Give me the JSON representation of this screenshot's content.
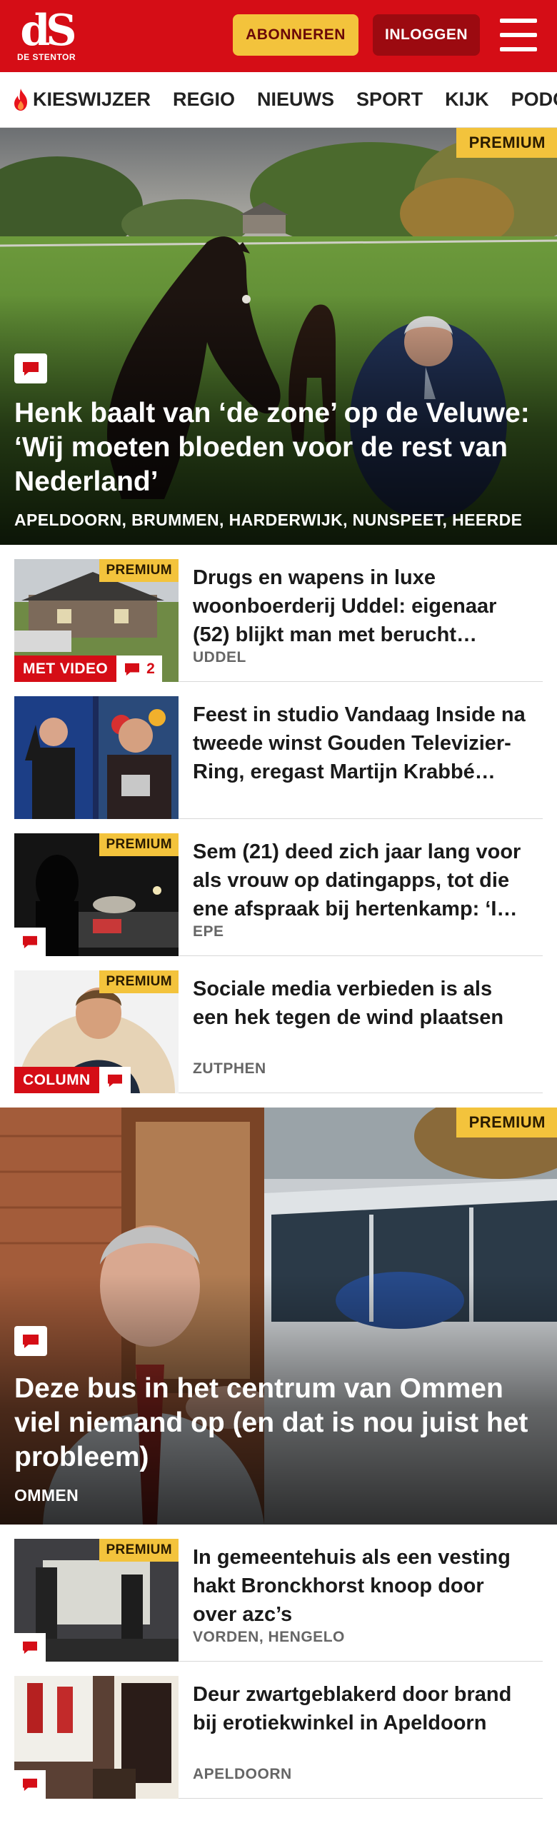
{
  "header": {
    "logo_mark": "dS",
    "logo_sub": "DE STENTOR",
    "subscribe_label": "ABONNEREN",
    "login_label": "INLOGGEN"
  },
  "nav": {
    "items": [
      "KIESWIJZER",
      "REGIO",
      "NIEUWS",
      "SPORT",
      "KIJK",
      "PODCAST"
    ]
  },
  "hero1": {
    "badge": "PREMIUM",
    "title": "Henk baalt van ‘de zone’ op de Veluwe: ‘Wij moeten bloeden voor de rest van Nederland’",
    "location": "APELDOORN, BRUMMEN, HARDERWIJK, NUNSPEET, HEERDE"
  },
  "articles1": [
    {
      "badge": "PREMIUM",
      "video_label": "MET VIDEO",
      "comments": "2",
      "title": "Drugs en wapens in luxe woonboerderij Uddel: eigenaar (52) blijkt man met berucht…",
      "location": "UDDEL"
    },
    {
      "title": "Feest in studio Vandaag Inside na tweede winst Gouden Televizier-Ring, eregast Martijn Krabbé…"
    },
    {
      "badge": "PREMIUM",
      "title": "Sem (21) deed zich jaar lang voor als vrouw op datingapps, tot die ene afspraak bij hertenkamp: ‘I…",
      "location": "EPE"
    },
    {
      "badge": "PREMIUM",
      "column_label": "COLUMN",
      "title": "Sociale media verbieden is als een hek tegen de wind plaatsen",
      "location": "ZUTPHEN"
    }
  ],
  "hero2": {
    "badge": "PREMIUM",
    "title": "Deze bus in het centrum van Ommen viel niemand op (en dat is nou juist het probleem)",
    "location": "OMMEN"
  },
  "articles2": [
    {
      "badge": "PREMIUM",
      "title": "In gemeentehuis als een vesting hakt Bronckhorst knoop door over azc’s",
      "location": "VORDEN, HENGELO"
    },
    {
      "title": "Deur zwartgeblakerd door brand bij erotiekwinkel in Apeldoorn",
      "location": "APELDOORN"
    }
  ],
  "colors": {
    "brand_red": "#d50d16",
    "premium_yellow": "#f3c33c",
    "login_dark_red": "#9c0a10"
  }
}
